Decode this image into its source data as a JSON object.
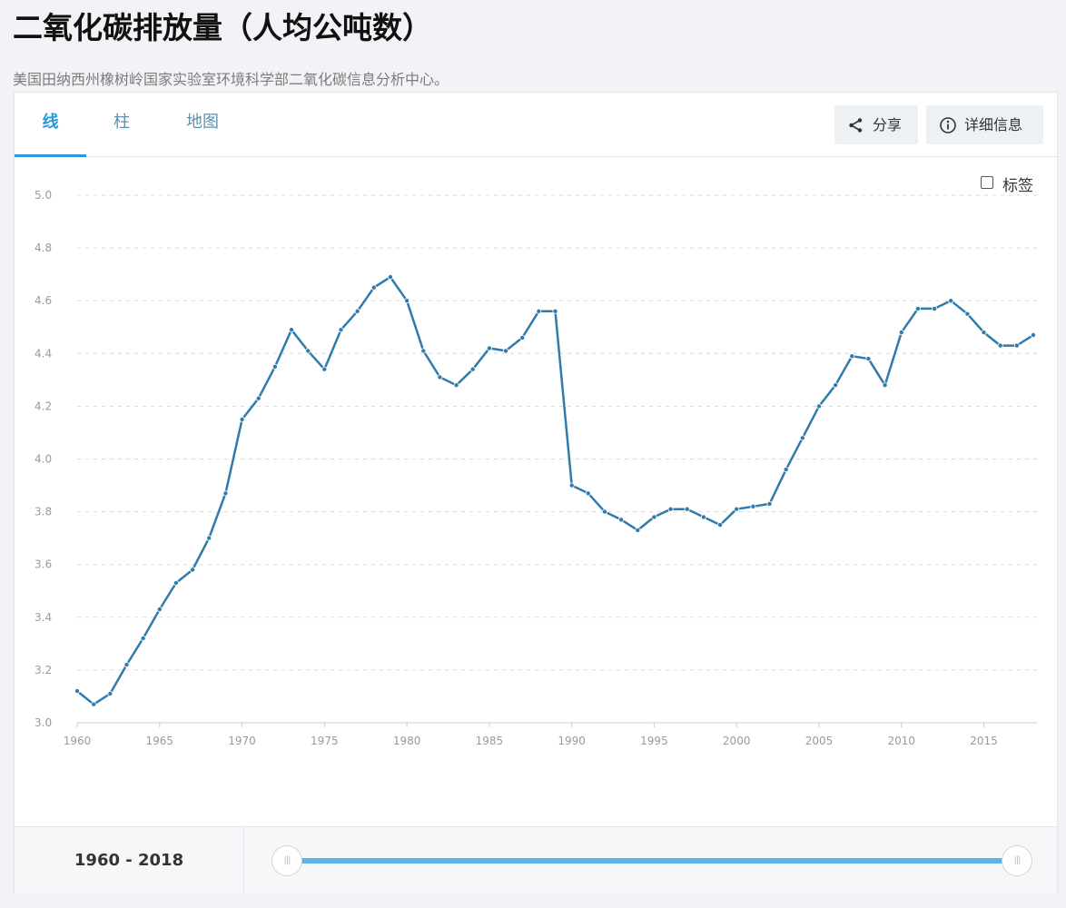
{
  "page": {
    "title": "二氧化碳排放量（人均公吨数）",
    "subtitle": "美国田纳西州橡树岭国家实验室环境科学部二氧化碳信息分析中心。"
  },
  "tabs": [
    {
      "label": "线",
      "active": true
    },
    {
      "label": "柱",
      "active": false
    },
    {
      "label": "地图",
      "active": false
    }
  ],
  "toolbar": {
    "share_label": "分享",
    "details_label": "详细信息",
    "share_icon": "share-icon",
    "info_icon": "info-icon"
  },
  "chart_options": {
    "labels_toggle_label": "标签",
    "labels_checked": false
  },
  "range": {
    "label": "1960 - 2018",
    "start_year": 1960,
    "end_year": 2018
  },
  "colors": {
    "line": "#2f7bab",
    "accent": "#2a97d9",
    "slider": "#5ab4e6",
    "grid": "#d6d9dd",
    "tick_label": "#9a9a9a"
  },
  "chart_data": {
    "type": "line",
    "title": "二氧化碳排放量（人均公吨数）",
    "xlabel": "",
    "ylabel": "",
    "ylim": [
      3.0,
      5.0
    ],
    "xlim": [
      1960,
      2018
    ],
    "yticks": [
      "3.0",
      "3.2",
      "3.4",
      "3.6",
      "3.8",
      "4.0",
      "4.2",
      "4.4",
      "4.6",
      "4.8",
      "5.0"
    ],
    "xticks": [
      "1960",
      "1965",
      "1970",
      "1975",
      "1980",
      "1985",
      "1990",
      "1995",
      "2000",
      "2005",
      "2010",
      "2015"
    ],
    "grid": true,
    "x": [
      1960,
      1961,
      1962,
      1963,
      1964,
      1965,
      1966,
      1967,
      1968,
      1969,
      1970,
      1971,
      1972,
      1973,
      1974,
      1975,
      1976,
      1977,
      1978,
      1979,
      1980,
      1981,
      1982,
      1983,
      1984,
      1985,
      1986,
      1987,
      1988,
      1989,
      1990,
      1991,
      1992,
      1993,
      1994,
      1995,
      1996,
      1997,
      1998,
      1999,
      2000,
      2001,
      2002,
      2003,
      2004,
      2005,
      2006,
      2007,
      2008,
      2009,
      2010,
      2011,
      2012,
      2013,
      2014,
      2015,
      2016,
      2017,
      2018
    ],
    "series": [
      {
        "values": [
          3.12,
          3.07,
          3.11,
          3.22,
          3.32,
          3.43,
          3.53,
          3.58,
          3.7,
          3.87,
          4.15,
          4.23,
          4.35,
          4.49,
          4.41,
          4.34,
          4.49,
          4.56,
          4.65,
          4.69,
          4.6,
          4.41,
          4.31,
          4.28,
          4.34,
          4.42,
          4.41,
          4.46,
          4.56,
          4.56,
          3.9,
          3.87,
          3.8,
          3.77,
          3.73,
          3.78,
          3.81,
          3.81,
          3.78,
          3.75,
          3.81,
          3.82,
          3.83,
          3.96,
          4.08,
          4.2,
          4.28,
          4.39,
          4.38,
          4.28,
          4.48,
          4.57,
          4.57,
          4.6,
          4.55,
          4.48,
          4.43,
          4.43,
          4.47
        ]
      }
    ]
  }
}
